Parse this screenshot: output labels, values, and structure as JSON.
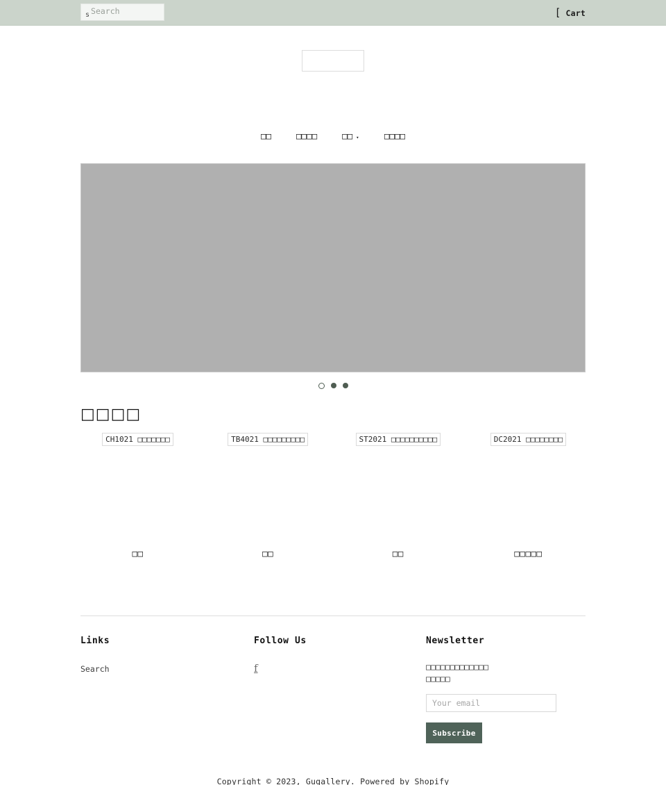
{
  "topbar": {
    "search": {
      "icon": "s",
      "icon_name": "search-icon",
      "placeholder": "Search",
      "value": ""
    },
    "cart": {
      "icon": "[",
      "label": "Cart"
    },
    "background_color": "#cbd4cb"
  },
  "logo": {
    "alt": ""
  },
  "nav": {
    "items": [
      {
        "label": "□□",
        "has_caret": false
      },
      {
        "label": "□□□□",
        "has_caret": false
      },
      {
        "label": "□□",
        "has_caret": true,
        "caret": "▾"
      },
      {
        "label": "□□□□",
        "has_caret": false
      }
    ]
  },
  "hero": {
    "placeholder_color": "#b0b0b0",
    "dots": [
      {
        "active": true
      },
      {
        "active": false
      },
      {
        "active": false
      }
    ]
  },
  "collection": {
    "title": "□□□□",
    "products": [
      {
        "broken_alt_code": "CH1021",
        "broken_alt_tofu": "□□□□□□□",
        "title": "□□"
      },
      {
        "broken_alt_code": "TB4021",
        "broken_alt_tofu": "□□□□□□□□□",
        "title": "□□"
      },
      {
        "broken_alt_code": "ST2021",
        "broken_alt_tofu": "□□□□□□□□□□",
        "title": "□□"
      },
      {
        "broken_alt_code": "DC2021",
        "broken_alt_tofu": "□□□□□□□□",
        "title": "□□□□□"
      }
    ]
  },
  "footer": {
    "links": {
      "heading": "Links",
      "items": [
        {
          "label": "Search"
        }
      ]
    },
    "follow": {
      "heading": "Follow Us",
      "items": [
        {
          "icon": "f",
          "icon_name": "facebook-icon"
        }
      ]
    },
    "newsletter": {
      "heading": "Newsletter",
      "description_line1": "□□□□□□□□□□□□□",
      "description_line2": "□□□□□",
      "email_placeholder": "Your email",
      "email_value": "",
      "subscribe_label": "Subscribe",
      "subscribe_color": "#4f6359"
    },
    "copyright": "Copyright © 2023, Gugallery. Powered by Shopify"
  }
}
